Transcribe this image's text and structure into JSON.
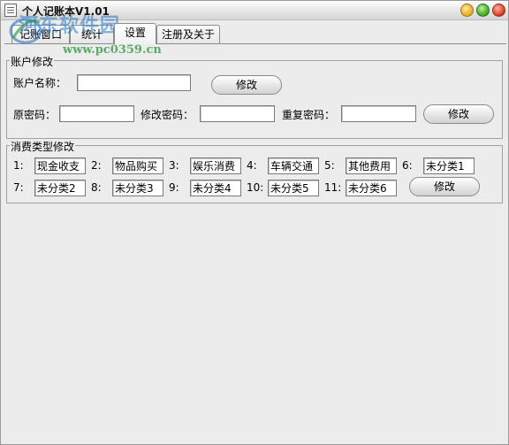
{
  "window": {
    "title": "个人记账本V1.01"
  },
  "watermark": {
    "text": "河东软件园",
    "url": "www.pc0359.cn"
  },
  "tabs": [
    {
      "label": "记账窗口",
      "active": false
    },
    {
      "label": "统计",
      "active": false
    },
    {
      "label": "设置",
      "active": true
    },
    {
      "label": "注册及关于",
      "active": false
    }
  ],
  "account_group": {
    "title": "账户修改",
    "account_name_label": "账户名称：",
    "account_name_value": "",
    "modify_button_1": "修改",
    "old_password_label": "原密码：",
    "old_password_value": "",
    "new_password_label": "修改密码：",
    "new_password_value": "",
    "repeat_password_label": "重复密码：",
    "repeat_password_value": "",
    "modify_button_2": "修改"
  },
  "category_group": {
    "title": "消费类型修改",
    "items": [
      {
        "num": "1:",
        "value": "现金收支"
      },
      {
        "num": "2:",
        "value": "物品购买"
      },
      {
        "num": "3:",
        "value": "娱乐消费"
      },
      {
        "num": "4:",
        "value": "车辆交通"
      },
      {
        "num": "5:",
        "value": "其他费用"
      },
      {
        "num": "6:",
        "value": "未分类1"
      },
      {
        "num": "7:",
        "value": "未分类2"
      },
      {
        "num": "8:",
        "value": "未分类3"
      },
      {
        "num": "9:",
        "value": "未分类4"
      },
      {
        "num": "10:",
        "value": "未分类5"
      },
      {
        "num": "11:",
        "value": "未分类6"
      }
    ],
    "modify_button": "修改"
  }
}
